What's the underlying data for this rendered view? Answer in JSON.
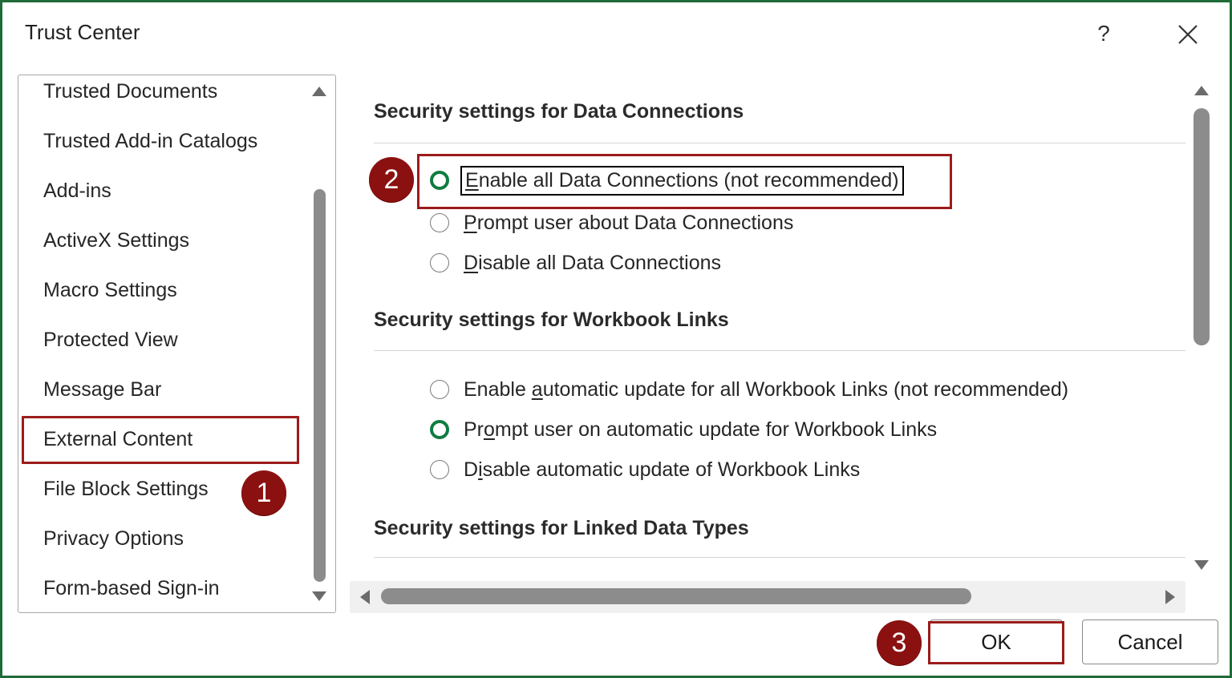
{
  "window": {
    "title": "Trust Center",
    "help_label": "?",
    "frame_color": "#1f6b3a"
  },
  "sidebar": {
    "items": [
      {
        "label": "Trusted Documents"
      },
      {
        "label": "Trusted Add-in Catalogs"
      },
      {
        "label": "Add-ins"
      },
      {
        "label": "ActiveX Settings"
      },
      {
        "label": "Macro Settings"
      },
      {
        "label": "Protected View"
      },
      {
        "label": "Message Bar"
      },
      {
        "label": "External Content",
        "selected": true
      },
      {
        "label": "File Block Settings"
      },
      {
        "label": "Privacy Options"
      },
      {
        "label": "Form-based Sign-in"
      }
    ]
  },
  "content": {
    "data_connections": {
      "title": "Security settings for Data Connections",
      "options": [
        {
          "pre": "",
          "key": "E",
          "post": "nable all Data Connections (not recommended)",
          "checked": true
        },
        {
          "pre": "",
          "key": "P",
          "post": "rompt user about Data Connections",
          "checked": false
        },
        {
          "pre": "",
          "key": "D",
          "post": "isable all Data Connections",
          "checked": false
        }
      ]
    },
    "workbook_links": {
      "title": "Security settings for Workbook Links",
      "options": [
        {
          "pre": "Enable ",
          "key": "a",
          "post": "utomatic update for all Workbook Links (not recommended)",
          "checked": false
        },
        {
          "pre": "Pr",
          "key": "o",
          "post": "mpt user on automatic update for Workbook Links",
          "checked": true
        },
        {
          "pre": "D",
          "key": "i",
          "post": "sable automatic update of Workbook Links",
          "checked": false
        }
      ]
    },
    "linked_data_types": {
      "title": "Security settings for Linked Data Types"
    }
  },
  "callouts": {
    "one": "1",
    "two": "2",
    "three": "3",
    "color": "#8b1111"
  },
  "buttons": {
    "ok_label": "OK",
    "cancel_label": "Cancel"
  },
  "accent_colors": {
    "radio_checked": "#107c41",
    "highlight_border": "#9c1b1b"
  }
}
